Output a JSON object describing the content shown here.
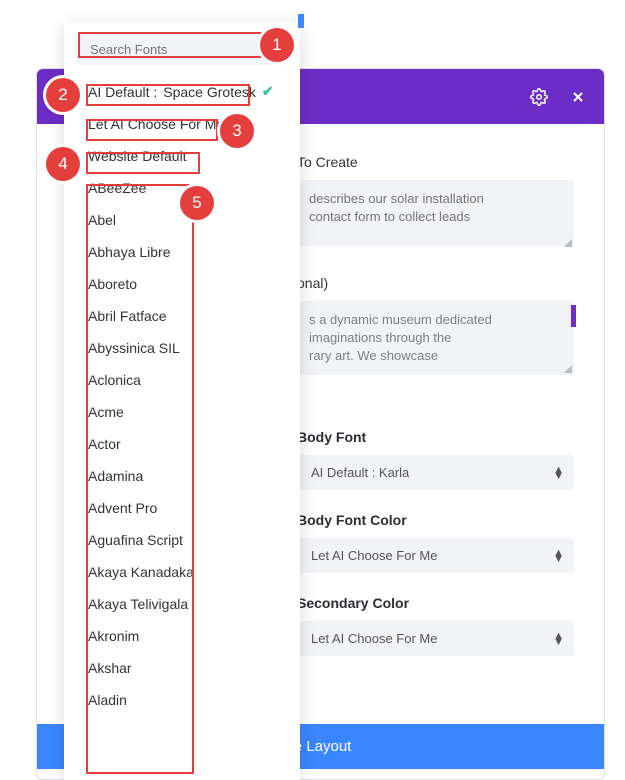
{
  "header": {
    "gear_icon": "gear-icon",
    "close_icon": "close-icon"
  },
  "search": {
    "placeholder": "Search Fonts"
  },
  "font_dropdown": {
    "ai_default_prefix": "AI Default :",
    "ai_default_font": "Space Grotesk",
    "let_ai_choose": "Let AI Choose For Me",
    "website_default": "Website Default",
    "fonts": [
      "ABeeZee",
      "Abel",
      "Abhaya Libre",
      "Aboreto",
      "Abril Fatface",
      "Abyssinica SIL",
      "Aclonica",
      "Acme",
      "Actor",
      "Adamina",
      "Advent Pro",
      "Aguafina Script",
      "Akaya Kanadaka",
      "Akaya Telivigala",
      "Akronim",
      "Akshar",
      "Aladin"
    ]
  },
  "form": {
    "create_label_partial": "To Create",
    "create_placeholder": "describes our solar installation\ncontact form to collect leads",
    "optional_label_partial": "onal)",
    "optional_text": "s a dynamic museum dedicated\nimaginations through the\nrary art. We showcase",
    "body_font_label": "Body Font",
    "body_font_value": "AI Default : Karla",
    "body_font_color_label": "Body Font Color",
    "body_font_color_value": "Let AI Choose For Me",
    "secondary_color_label": "Secondary Color",
    "secondary_color_value": "Let AI Choose For Me",
    "generate_label_partial": "te Layout"
  },
  "annotations": {
    "b1": "1",
    "b2": "2",
    "b3": "3",
    "b4": "4",
    "b5": "5"
  }
}
